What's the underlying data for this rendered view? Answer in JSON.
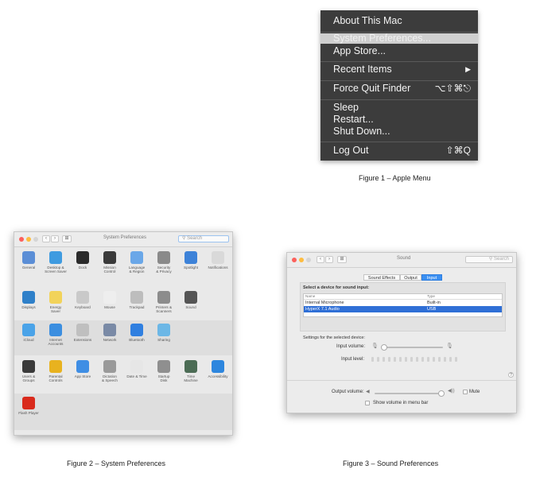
{
  "apple_menu": {
    "items": [
      {
        "label": "About This Mac",
        "shortcut": ""
      },
      {
        "label": "System Preferences...",
        "shortcut": ""
      },
      {
        "label": "App Store...",
        "shortcut": ""
      },
      {
        "label": "Recent Items",
        "shortcut": "▶"
      },
      {
        "label": "Force Quit Finder",
        "shortcut": "⌥⇧⌘⎋"
      },
      {
        "label": "Sleep",
        "shortcut": ""
      },
      {
        "label": "Restart...",
        "shortcut": ""
      },
      {
        "label": "Shut Down...",
        "shortcut": ""
      },
      {
        "label": "Log Out",
        "shortcut": "⇧⌘Q"
      }
    ],
    "highlighted_index": 1
  },
  "captions": {
    "fig1": "Figure 1 – Apple Menu",
    "fig2": "Figure 2 – System Preferences",
    "fig3": "Figure 3 – Sound Preferences"
  },
  "system_preferences": {
    "title": "System Preferences",
    "search_placeholder": "Search",
    "rows": [
      [
        {
          "label": "General",
          "color": "#5b8ed6",
          "icon": "general-icon"
        },
        {
          "label": "Desktop &\nScreen Saver",
          "color": "#3f9be0",
          "icon": "desktop-icon"
        },
        {
          "label": "Dock",
          "color": "#2b2b2b",
          "icon": "dock-icon"
        },
        {
          "label": "Mission\nControl",
          "color": "#3a3a3a",
          "icon": "mission-control-icon"
        },
        {
          "label": "Language\n& Region",
          "color": "#6aa7e8",
          "icon": "language-icon"
        },
        {
          "label": "Security\n& Privacy",
          "color": "#8a8a8a",
          "icon": "security-icon"
        },
        {
          "label": "Spotlight",
          "color": "#3d82d8",
          "icon": "spotlight-icon"
        },
        {
          "label": "Notifications",
          "color": "#d9d9d9",
          "icon": "notifications-icon"
        }
      ],
      [
        {
          "label": "Displays",
          "color": "#2f80c9",
          "icon": "displays-icon"
        },
        {
          "label": "Energy\nSaver",
          "color": "#f2d35a",
          "icon": "energy-icon"
        },
        {
          "label": "Keyboard",
          "color": "#c9c9c9",
          "icon": "keyboard-icon"
        },
        {
          "label": "Mouse",
          "color": "#eeeeee",
          "icon": "mouse-icon"
        },
        {
          "label": "Trackpad",
          "color": "#bdbdbd",
          "icon": "trackpad-icon"
        },
        {
          "label": "Printers &\nScanners",
          "color": "#8c8c8c",
          "icon": "printer-icon"
        },
        {
          "label": "Sound",
          "color": "#555555",
          "icon": "sound-icon"
        }
      ],
      [
        {
          "label": "iCloud",
          "color": "#4aa3e8",
          "icon": "icloud-icon"
        },
        {
          "label": "Internet\nAccounts",
          "color": "#3b8ee0",
          "icon": "internet-accounts-icon"
        },
        {
          "label": "Extensions",
          "color": "#bfbfbf",
          "icon": "extensions-icon"
        },
        {
          "label": "Network",
          "color": "#7a8aa6",
          "icon": "network-icon"
        },
        {
          "label": "Bluetooth",
          "color": "#2f7fe0",
          "icon": "bluetooth-icon"
        },
        {
          "label": "Sharing",
          "color": "#6cb7e6",
          "icon": "sharing-icon"
        }
      ],
      [
        {
          "label": "Users &\nGroups",
          "color": "#3a3a3a",
          "icon": "users-icon"
        },
        {
          "label": "Parental\nControls",
          "color": "#e8b21f",
          "icon": "parental-icon"
        },
        {
          "label": "App Store",
          "color": "#3f8ee4",
          "icon": "appstore-icon"
        },
        {
          "label": "Dictation\n& Speech",
          "color": "#9a9a9a",
          "icon": "dictation-icon"
        },
        {
          "label": "Date & Time",
          "color": "#e6e6e6",
          "icon": "datetime-icon"
        },
        {
          "label": "Startup\nDisk",
          "color": "#8f8f8f",
          "icon": "startup-disk-icon"
        },
        {
          "label": "Time\nMachine",
          "color": "#4c6c55",
          "icon": "timemachine-icon"
        },
        {
          "label": "Accessibility",
          "color": "#2d86de",
          "icon": "accessibility-icon"
        }
      ],
      [
        {
          "label": "Flash Player",
          "color": "#d92a1c",
          "icon": "flash-icon"
        }
      ]
    ]
  },
  "sound": {
    "title": "Sound",
    "search_placeholder": "Search",
    "tabs": [
      "Sound Effects",
      "Output",
      "Input"
    ],
    "selected_tab": 2,
    "heading": "Select a device for sound input:",
    "columns": [
      "Name",
      "Type"
    ],
    "devices": [
      {
        "name": "Internal Microphone",
        "type": "Built-in"
      },
      {
        "name": "HyperX 7.1 Audio",
        "type": "USB"
      }
    ],
    "selected_device": 1,
    "settings_label": "Settings for the selected device:",
    "input_volume_label": "Input volume:",
    "input_volume": 0.05,
    "input_level_label": "Input level:",
    "output_volume_label": "Output volume:",
    "output_volume": 0.95,
    "mute_label": "Mute",
    "show_volume_label": "Show volume in menu bar",
    "help": "?"
  }
}
